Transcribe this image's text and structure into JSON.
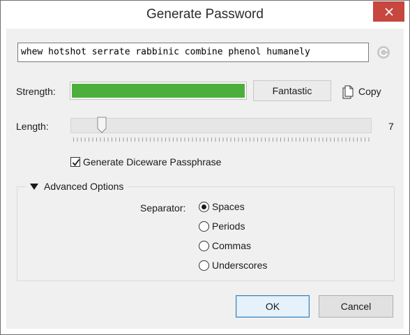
{
  "window": {
    "title": "Generate Password"
  },
  "password": {
    "value": "whew hotshot serrate rabbinic combine phenol humanely"
  },
  "strength": {
    "label": "Strength:",
    "fraction": 1.0,
    "rating": "Fantastic",
    "bar_color": "#4caf3c"
  },
  "copy": {
    "label": "Copy",
    "icon": "copy-icon"
  },
  "length": {
    "label": "Length:",
    "value": "7"
  },
  "diceware": {
    "label": "Generate Diceware Passphrase",
    "checked": true
  },
  "advanced": {
    "label": "Advanced Options",
    "expanded": true,
    "separator_label": "Separator:",
    "options": [
      {
        "label": "Spaces",
        "selected": true
      },
      {
        "label": "Periods",
        "selected": false
      },
      {
        "label": "Commas",
        "selected": false
      },
      {
        "label": "Underscores",
        "selected": false
      }
    ]
  },
  "buttons": {
    "ok": "OK",
    "cancel": "Cancel"
  },
  "colors": {
    "close_button": "#c7463e",
    "ok_border": "#3c7fb1"
  }
}
